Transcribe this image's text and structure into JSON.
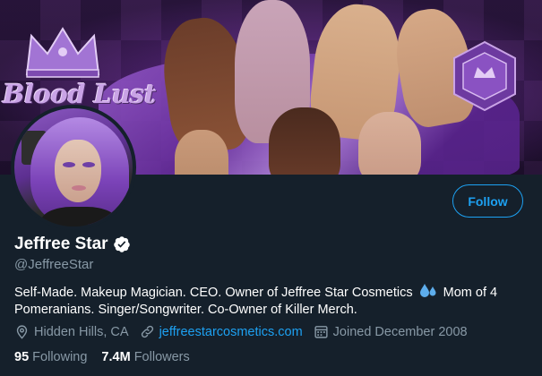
{
  "banner": {
    "logo_text": "Blood Lust",
    "accent_color": "#9b59d0"
  },
  "profile": {
    "display_name": "Jeffree Star",
    "verified": true,
    "handle": "@JeffreeStar",
    "bio_before_emoji": "Self-Made. Makeup Magician. CEO. Owner of Jeffree Star Cosmetics",
    "bio_emoji": "sweat-droplets-icon",
    "bio_after_emoji": "Mom of 4 Pomeranians. Singer/Songwriter. Co-Owner of Killer Merch.",
    "location": "Hidden Hills, CA",
    "website": "jeffreestarcosmetics.com",
    "joined": "Joined December 2008"
  },
  "stats": {
    "following_count": "95",
    "following_label": "Following",
    "followers_count": "7.4M",
    "followers_label": "Followers"
  },
  "actions": {
    "follow_label": "Follow"
  },
  "colors": {
    "background": "#15202b",
    "accent": "#1da1f2",
    "muted": "#8899a6",
    "text": "#ffffff"
  }
}
